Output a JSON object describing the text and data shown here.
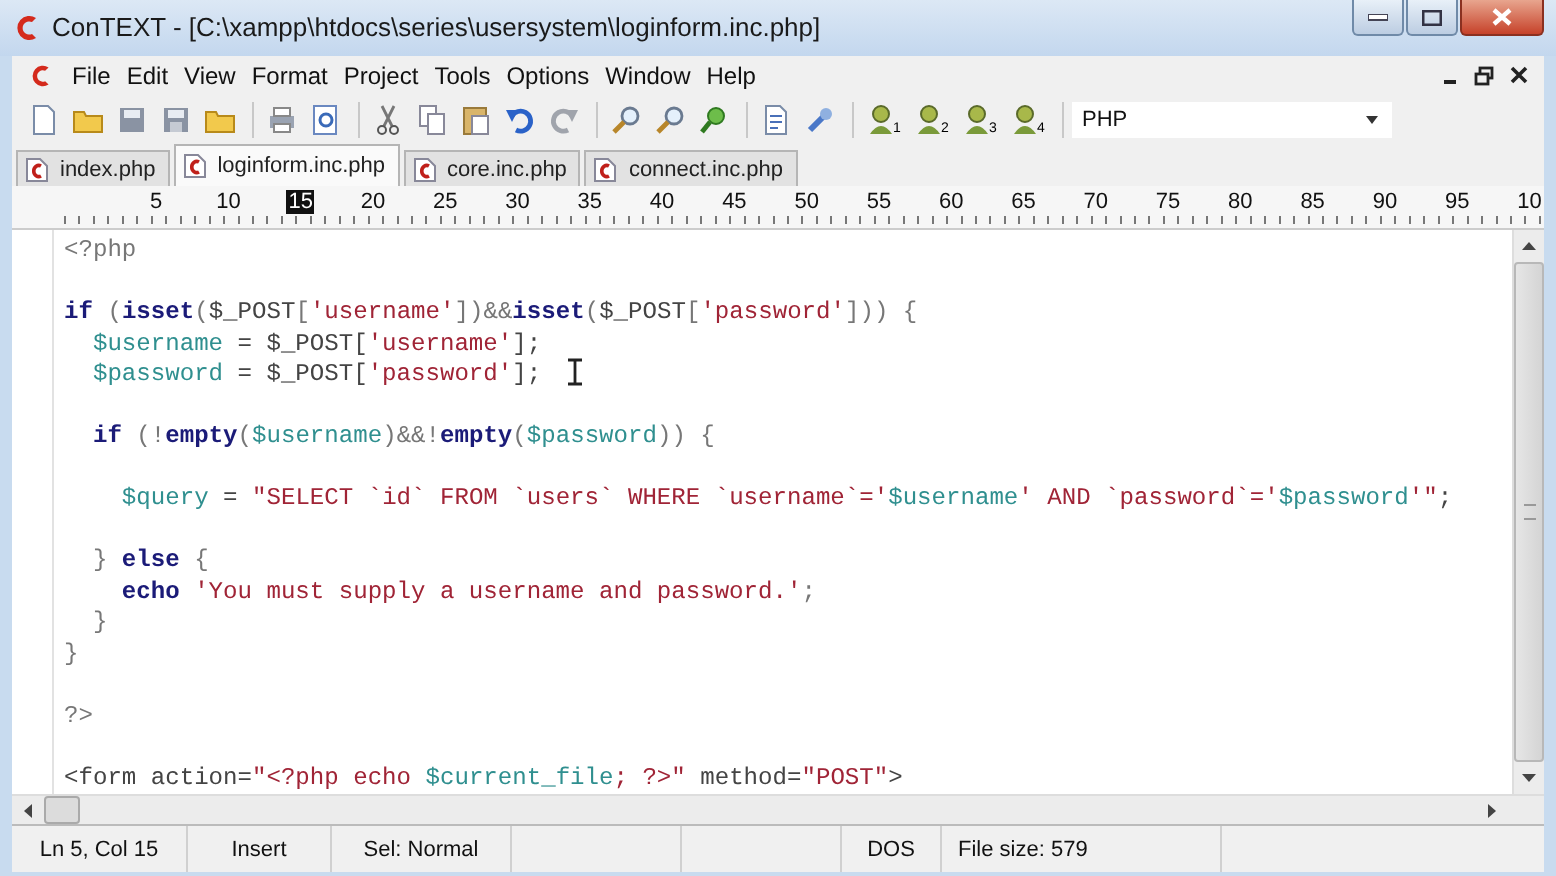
{
  "window": {
    "title": "ConTEXT - [C:\\xampp\\htdocs\\series\\usersystem\\loginform.inc.php]"
  },
  "menu": [
    "File",
    "Edit",
    "View",
    "Format",
    "Project",
    "Tools",
    "Options",
    "Window",
    "Help"
  ],
  "toolbar": {
    "user_tools": [
      "1",
      "2",
      "3",
      "4"
    ],
    "language": "PHP"
  },
  "tabs": [
    {
      "label": "index.php",
      "selected": false
    },
    {
      "label": "loginform.inc.php",
      "selected": true
    },
    {
      "label": "core.inc.php",
      "selected": false
    },
    {
      "label": "connect.inc.php",
      "selected": false
    }
  ],
  "ruler": [
    {
      "label": "5",
      "cursor": false
    },
    {
      "label": "10",
      "cursor": false
    },
    {
      "label": "15",
      "cursor": true
    },
    {
      "label": "20",
      "cursor": false
    },
    {
      "label": "25",
      "cursor": false
    },
    {
      "label": "30",
      "cursor": false
    },
    {
      "label": "35",
      "cursor": false
    },
    {
      "label": "40",
      "cursor": false
    },
    {
      "label": "45",
      "cursor": false
    },
    {
      "label": "50",
      "cursor": false
    },
    {
      "label": "55",
      "cursor": false
    },
    {
      "label": "60",
      "cursor": false
    },
    {
      "label": "65",
      "cursor": false
    },
    {
      "label": "70",
      "cursor": false
    },
    {
      "label": "75",
      "cursor": false
    },
    {
      "label": "80",
      "cursor": false
    },
    {
      "label": "85",
      "cursor": false
    },
    {
      "label": "90",
      "cursor": false
    },
    {
      "label": "95",
      "cursor": false
    },
    {
      "label": "10",
      "cursor": false
    }
  ],
  "code": [
    {
      "kind": "code",
      "tokens": [
        {
          "kind": "punct",
          "text": "<?php"
        }
      ]
    },
    {
      "kind": "blank"
    },
    {
      "kind": "code",
      "tokens": [
        {
          "kind": "keyword",
          "text": "if"
        },
        {
          "kind": "punct",
          "text": " ("
        },
        {
          "kind": "keyword",
          "text": "isset"
        },
        {
          "kind": "punct",
          "text": "("
        },
        {
          "kind": "plain",
          "text": "$_POST"
        },
        {
          "kind": "punct",
          "text": "["
        },
        {
          "kind": "string",
          "text": "'username'"
        },
        {
          "kind": "punct",
          "text": "])&&"
        },
        {
          "kind": "keyword",
          "text": "isset"
        },
        {
          "kind": "punct",
          "text": "("
        },
        {
          "kind": "plain",
          "text": "$_POST"
        },
        {
          "kind": "punct",
          "text": "["
        },
        {
          "kind": "string",
          "text": "'password'"
        },
        {
          "kind": "punct",
          "text": "])) {"
        }
      ]
    },
    {
      "kind": "code",
      "tokens": [
        {
          "kind": "variable",
          "text": "  $username"
        },
        {
          "kind": "plain",
          "text": " = $_POST["
        },
        {
          "kind": "string",
          "text": "'username'"
        },
        {
          "kind": "plain",
          "text": "];"
        }
      ]
    },
    {
      "kind": "code",
      "tokens": [
        {
          "kind": "variable",
          "text": "  $password"
        },
        {
          "kind": "plain",
          "text": " = $_POST["
        },
        {
          "kind": "string",
          "text": "'password'"
        },
        {
          "kind": "plain",
          "text": "];"
        }
      ]
    },
    {
      "kind": "blank"
    },
    {
      "kind": "code",
      "tokens": [
        {
          "kind": "keyword",
          "text": "  if"
        },
        {
          "kind": "punct",
          "text": " (!"
        },
        {
          "kind": "keyword",
          "text": "empty"
        },
        {
          "kind": "punct",
          "text": "("
        },
        {
          "kind": "variable",
          "text": "$username"
        },
        {
          "kind": "punct",
          "text": ")&&!"
        },
        {
          "kind": "keyword",
          "text": "empty"
        },
        {
          "kind": "punct",
          "text": "("
        },
        {
          "kind": "variable",
          "text": "$password"
        },
        {
          "kind": "punct",
          "text": ")) {"
        }
      ]
    },
    {
      "kind": "blank"
    },
    {
      "kind": "code",
      "tokens": [
        {
          "kind": "variable",
          "text": "    $query"
        },
        {
          "kind": "plain",
          "text": " = "
        },
        {
          "kind": "string",
          "text": "\"SELECT `id` FROM `users` WHERE `username`='"
        },
        {
          "kind": "variable",
          "text": "$username"
        },
        {
          "kind": "string",
          "text": "' AND `password`='"
        },
        {
          "kind": "variable",
          "text": "$password"
        },
        {
          "kind": "string",
          "text": "'\""
        },
        {
          "kind": "plain",
          "text": ";"
        }
      ]
    },
    {
      "kind": "blank"
    },
    {
      "kind": "code",
      "tokens": [
        {
          "kind": "punct",
          "text": "  } "
        },
        {
          "kind": "keyword",
          "text": "else"
        },
        {
          "kind": "punct",
          "text": " {"
        }
      ]
    },
    {
      "kind": "code",
      "tokens": [
        {
          "kind": "keyword",
          "text": "    echo"
        },
        {
          "kind": "string",
          "text": " 'You must supply a username and password.'"
        },
        {
          "kind": "punct",
          "text": ";"
        }
      ]
    },
    {
      "kind": "code",
      "tokens": [
        {
          "kind": "punct",
          "text": "  }"
        }
      ]
    },
    {
      "kind": "code",
      "tokens": [
        {
          "kind": "punct",
          "text": "}"
        }
      ]
    },
    {
      "kind": "blank"
    },
    {
      "kind": "code",
      "tokens": [
        {
          "kind": "punct",
          "text": "?>"
        }
      ]
    },
    {
      "kind": "blank"
    },
    {
      "kind": "code",
      "tokens": [
        {
          "kind": "plain",
          "text": "<form action="
        },
        {
          "kind": "string",
          "text": "\"<?php echo "
        },
        {
          "kind": "variable",
          "text": "$current_file"
        },
        {
          "kind": "string",
          "text": "; ?>\""
        },
        {
          "kind": "plain",
          "text": " method="
        },
        {
          "kind": "string",
          "text": "\"POST\""
        },
        {
          "kind": "plain",
          "text": ">"
        }
      ]
    }
  ],
  "status_bar": {
    "position": "Ln 5, Col 15",
    "mode": "Insert",
    "selection": "Sel: Normal",
    "line_ends": "DOS",
    "file_size": "File size: 579"
  }
}
